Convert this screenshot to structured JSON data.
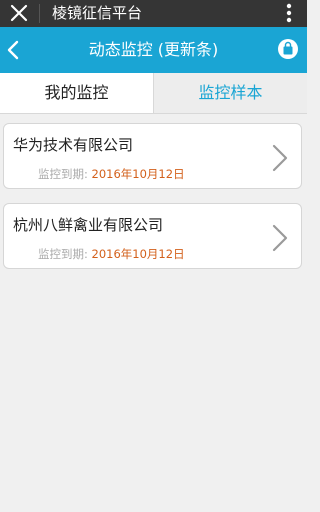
{
  "topbar": {
    "title": "棱镜征信平台"
  },
  "navbar": {
    "title": "动态监控 (更新条)"
  },
  "tabs": [
    {
      "label": "我的监控"
    },
    {
      "label": "监控样本"
    }
  ],
  "companies": [
    {
      "name": "华为技术有限公司",
      "expiry_label": "监控到期:",
      "expiry_date": "2016年10月12日"
    },
    {
      "name": "杭州八鲜禽业有限公司",
      "expiry_label": "监控到期:",
      "expiry_date": "2016年10月12日"
    }
  ],
  "colors": {
    "accent": "#1aa5d4",
    "topbar_bg": "#353535",
    "date": "#d3601b"
  },
  "icons": {
    "close": "close-icon",
    "more": "more-vertical-icon",
    "back": "back-chevron-icon",
    "bag": "bag-icon",
    "chevron": "chevron-right-icon"
  }
}
